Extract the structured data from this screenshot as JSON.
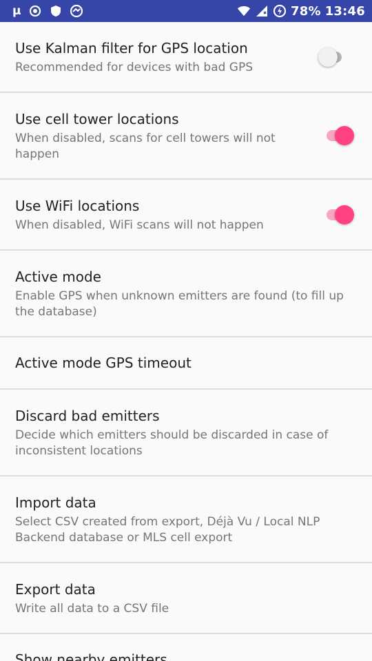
{
  "status_bar": {
    "left_app_glyph": "μ",
    "icons_left": [
      "record-icon",
      "shield-icon",
      "vpn-icon"
    ],
    "icons_right": [
      "wifi-icon",
      "cell-signal-icon",
      "data-saver-icon"
    ],
    "battery": "78%",
    "time": "13:46"
  },
  "settings": {
    "kalman": {
      "title": "Use Kalman filter for GPS location",
      "summary": "Recommended for devices with bad GPS",
      "enabled": false
    },
    "cell_tower": {
      "title": "Use cell tower locations",
      "summary": "When disabled, scans for cell towers will not happen",
      "enabled": true
    },
    "wifi": {
      "title": "Use WiFi locations",
      "summary": "When disabled, WiFi scans will not happen",
      "enabled": true
    },
    "active_mode": {
      "title": "Active mode",
      "summary": "Enable GPS when unknown emitters are found (to fill up the database)"
    },
    "active_mode_timeout": {
      "title": "Active mode GPS timeout"
    },
    "discard_bad": {
      "title": "Discard bad emitters",
      "summary": "Decide which emitters should be discarded in case of inconsistent locations"
    },
    "import_data": {
      "title": "Import data",
      "summary": "Select CSV created from export, Déjà Vu / Local NLP Backend database or MLS cell export"
    },
    "export_data": {
      "title": "Export data",
      "summary": "Write all data to a CSV file"
    },
    "show_nearby": {
      "title": "Show nearby emitters"
    }
  },
  "colors": {
    "status_bar": "#3545a8",
    "accent": "#ff4081",
    "divider": "#dedede"
  }
}
